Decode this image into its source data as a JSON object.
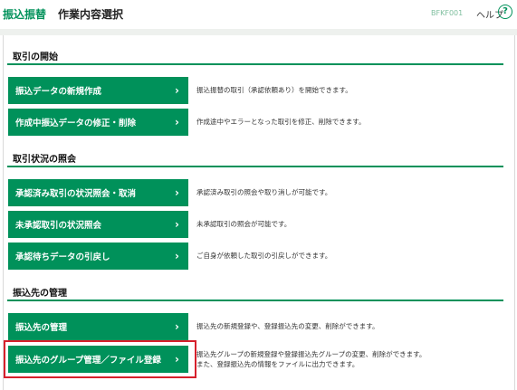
{
  "header": {
    "title_main": "振込振替",
    "title_sub": "作業内容選択",
    "screen_id": "BFKF001",
    "help_label": "ヘルプ",
    "help_icon": "?"
  },
  "sections": {
    "start": {
      "title": "取引の開始",
      "items": [
        {
          "label": "振込データの新規作成",
          "desc": "振込振替の取引（承認依頼あり）を開始できます。"
        },
        {
          "label": "作成中振込データの修正・削除",
          "desc": "作成途中やエラーとなった取引を修正、削除できます。"
        }
      ]
    },
    "status": {
      "title": "取引状況の照会",
      "items": [
        {
          "label": "承認済み取引の状況照会・取消",
          "desc": "承認済み取引の照会や取り消しが可能です。"
        },
        {
          "label": "未承認取引の状況照会",
          "desc": "未承認取引の照会が可能です。"
        },
        {
          "label": "承認待ちデータの引戻し",
          "desc": "ご自身が依頼した取引の引戻しができます。"
        }
      ]
    },
    "payee": {
      "title": "振込先の管理",
      "items": [
        {
          "label": "振込先の管理",
          "desc": "振込先の新規登録や、登録振込先の変更、削除ができます。"
        },
        {
          "label": "振込先のグループ管理／ファイル登録",
          "desc": "振込先グループの新規登録や登録振込先グループの変更、削除ができます。",
          "desc2": "また、登録振込先の情報をファイルに出力できます。"
        }
      ]
    }
  },
  "chevron": "›",
  "colors": {
    "accent": "#00915a",
    "highlight": "#d6202c"
  }
}
